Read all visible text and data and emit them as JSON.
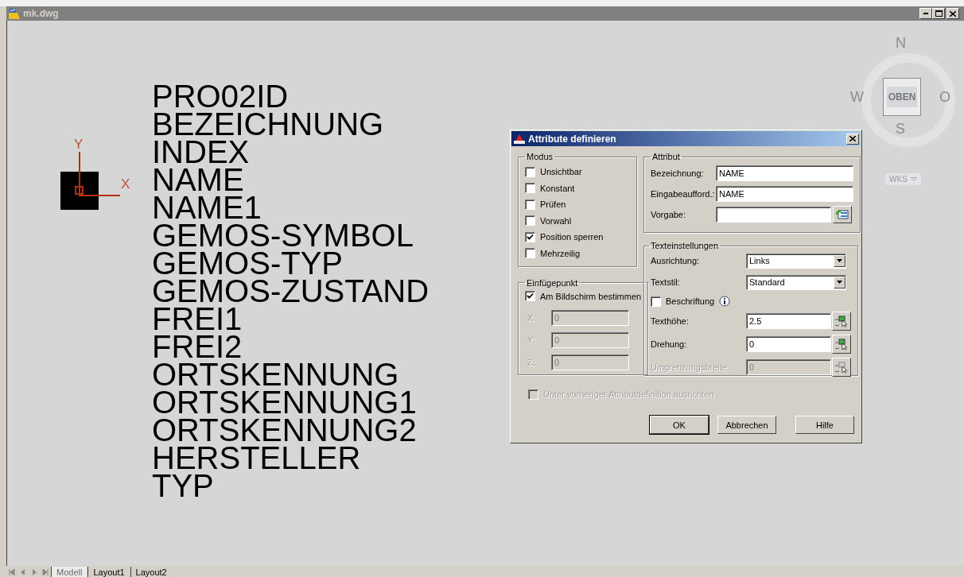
{
  "window": {
    "title": "mk.dwg"
  },
  "drawing": {
    "attribute_tags": [
      "PRO02ID",
      "BEZEICHNUNG",
      "INDEX",
      "NAME",
      "NAME1",
      "GEMOS-SYMBOL",
      "GEMOS-TYP",
      "GEMOS-ZUSTAND",
      "FREI1",
      "FREI2",
      "ORTSKENNUNG",
      "ORTSKENNUNG1",
      "ORTSKENNUNG2",
      "HERSTELLER",
      "TYP"
    ],
    "ucs": {
      "x_label": "X",
      "y_label": "Y"
    }
  },
  "viewcube": {
    "face": "OBEN",
    "north": "N",
    "south": "S",
    "west": "W",
    "east": "O",
    "coordinate_system": "WKS"
  },
  "dialog": {
    "title": "Attribute definieren",
    "modus": {
      "title": "Modus",
      "options": [
        {
          "label": "Unsichtbar",
          "checked": false
        },
        {
          "label": "Konstant",
          "checked": false
        },
        {
          "label": "Prüfen",
          "checked": false
        },
        {
          "label": "Vorwahl",
          "checked": false
        },
        {
          "label": "Position sperren",
          "checked": true
        },
        {
          "label": "Mehrzeilig",
          "checked": false
        }
      ]
    },
    "insertion_point": {
      "title": "Einfügepunkt",
      "on_screen": {
        "label": "Am Bildschirm bestimmen",
        "checked": true
      },
      "coordinates": [
        {
          "label": "X:",
          "value": "0",
          "disabled": true
        },
        {
          "label": "Y:",
          "value": "0",
          "disabled": true
        },
        {
          "label": "Z:",
          "value": "0",
          "disabled": true
        }
      ]
    },
    "attribute": {
      "title": "Attribut",
      "fields": [
        {
          "kind": "text",
          "label": "Bezeichnung:",
          "value": "NAME"
        },
        {
          "kind": "text",
          "label": "Eingabeaufford.:",
          "value": "NAME"
        },
        {
          "kind": "field_button",
          "label": "Vorgabe:"
        }
      ]
    },
    "text_settings": {
      "title": "Texteinstellungen",
      "rows": [
        {
          "kind": "dropdown",
          "label": "Ausrichtung:",
          "value": "Links"
        },
        {
          "kind": "dropdown",
          "label": "Textstil:",
          "value": "Standard"
        },
        {
          "kind": "checkbox",
          "label": "Beschriftung",
          "checked": false
        },
        {
          "kind": "pick",
          "label": "Texthöhe:",
          "value": "2.5",
          "disabled": false
        },
        {
          "kind": "pick",
          "label": "Drehung:",
          "value": "0",
          "disabled": false
        },
        {
          "kind": "pick",
          "label": "Umgrenzungsbreite:",
          "value": "0",
          "disabled": true
        }
      ]
    },
    "align_option": {
      "label": "Unter vorheriger Attributdefinition ausrichten",
      "checked": false,
      "disabled": true
    },
    "buttons": [
      {
        "label": "OK",
        "default": true
      },
      {
        "label": "Abbrechen",
        "default": false
      },
      {
        "label": "Hilfe",
        "default": false
      }
    ]
  },
  "layout_tabs": [
    {
      "label": "Modell",
      "selected": true
    },
    {
      "label": "Layout1",
      "selected": false
    },
    {
      "label": "Layout2",
      "selected": false
    }
  ]
}
